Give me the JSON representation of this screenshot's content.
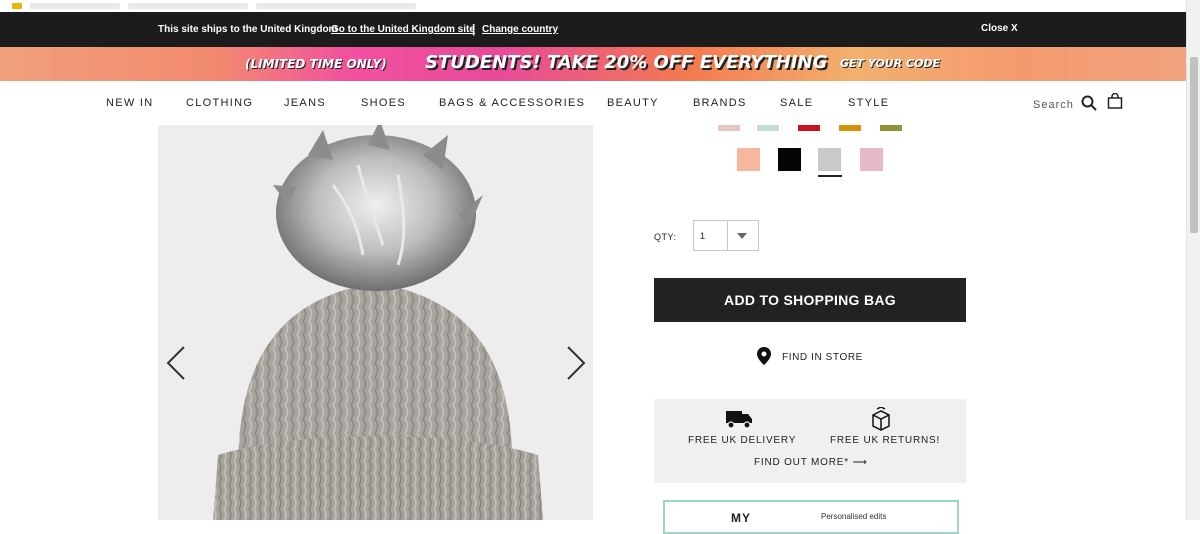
{
  "shipping_bar": {
    "message": "This site ships to the United Kingdom",
    "link_uk": "Go to the United Kingdom site",
    "separator": "|",
    "link_change": "Change country",
    "close": "Close X"
  },
  "promo_banner": {
    "limited": "(LIMITED TIME ONLY)",
    "headline": "STUDENTS! TAKE 20% OFF EVERYTHING",
    "cta": "GET YOUR CODE"
  },
  "nav": {
    "items": [
      "NEW IN",
      "CLOTHING",
      "JEANS",
      "SHOES",
      "BAGS & ACCESSORIES",
      "BEAUTY",
      "BRANDS",
      "SALE",
      "STYLE"
    ],
    "search_label": "Search",
    "icons": {
      "search": "search-icon",
      "bag": "shopping-bag-icon"
    }
  },
  "product": {
    "swatch_colors_row1": [
      "#e8c6c4",
      "#c5ddd6",
      "#c8131c",
      "#d4920c",
      "#8d933b"
    ],
    "swatch_colors_row2": [
      "#f4b99c",
      "#050505",
      "#c9c9c9",
      "#e6b8c8"
    ],
    "selected_swatch_index": 2
  },
  "purchase": {
    "qty_label": "QTY:",
    "qty_value": "1",
    "add_to_bag": "ADD TO SHOPPING BAG",
    "find_in_store": "FIND IN STORE"
  },
  "delivery": {
    "free_delivery": "FREE UK DELIVERY",
    "free_returns": "FREE UK RETURNS!",
    "find_out_more": "FIND OUT MORE* ⟶"
  },
  "my_banner": {
    "title": "MY",
    "subtitle": "Personalised edits"
  }
}
